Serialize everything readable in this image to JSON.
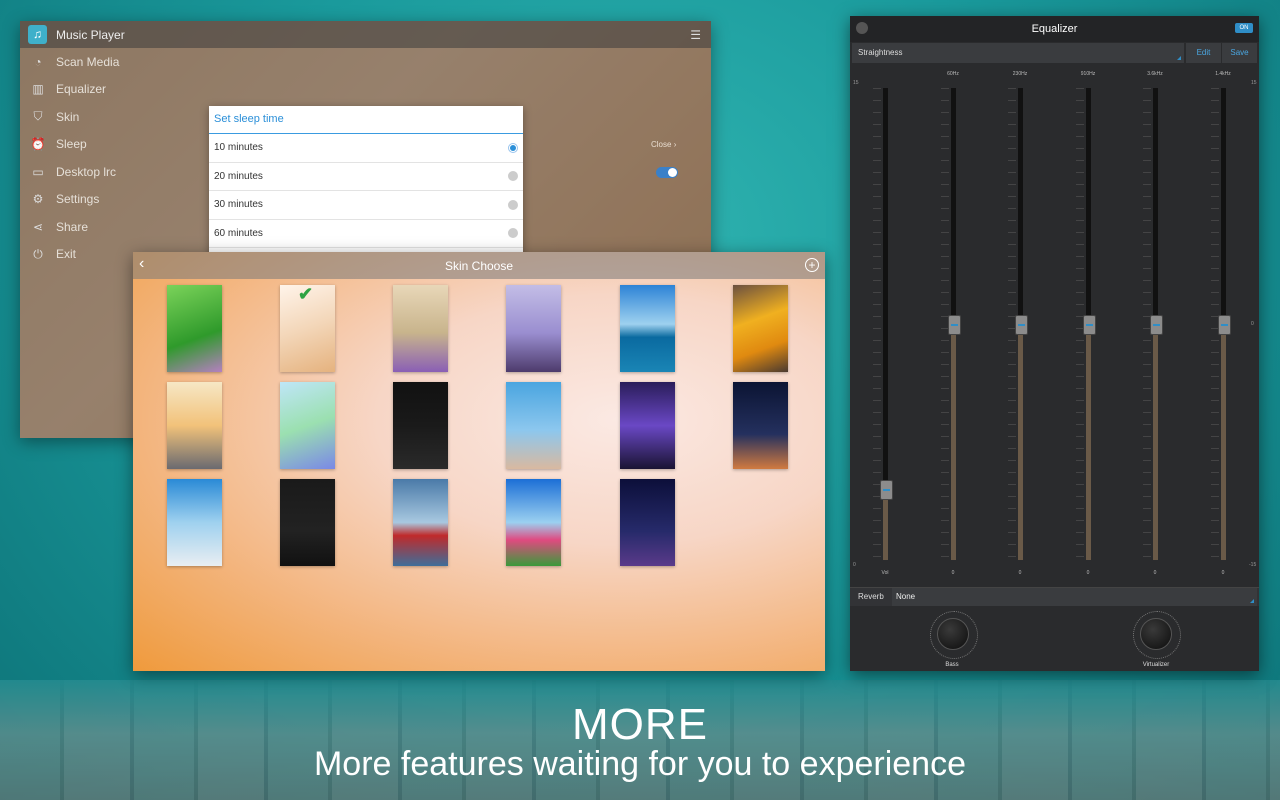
{
  "player": {
    "title": "Music Player",
    "menu": [
      {
        "label": "Scan Media",
        "icon": "scan-icon"
      },
      {
        "label": "Equalizer",
        "icon": "equalizer-icon"
      },
      {
        "label": "Skin",
        "icon": "shirt-icon"
      },
      {
        "label": "Sleep",
        "icon": "alarm-icon"
      },
      {
        "label": "Desktop lrc",
        "icon": "lyrics-icon"
      },
      {
        "label": "Settings",
        "icon": "gear-icon"
      },
      {
        "label": "Share",
        "icon": "share-icon"
      },
      {
        "label": "Exit",
        "icon": "power-icon"
      }
    ],
    "close_text": "Close"
  },
  "sleep_dialog": {
    "title": "Set sleep time",
    "options": [
      "10 minutes",
      "20 minutes",
      "30 minutes",
      "60 minutes"
    ],
    "selected": "10 minutes"
  },
  "skin": {
    "title": "Skin Choose",
    "selected_index": 1,
    "thumbnails": [
      "green-flower",
      "cherry-blossom",
      "purple-flowers",
      "lavender-sky",
      "ocean-sunset",
      "yellow-flowers",
      "pier-sunset",
      "butterfly",
      "dark-rose",
      "red-heart-balloons",
      "night-bokeh",
      "dusk-sky",
      "wooden-pier",
      "dandelion",
      "red-maple-leaf",
      "daisy-field",
      "city-tower-night"
    ]
  },
  "equalizer": {
    "title": "Equalizer",
    "power": "ON",
    "preset": "Straightness",
    "edit_label": "Edit",
    "save_label": "Save",
    "scale_top": "15",
    "scale_mid": "0",
    "scale_bottom": "-15",
    "scale_left_top": "15",
    "scale_left_bottom": "0",
    "bands": [
      {
        "freq": "",
        "label": "Vol",
        "level": 0.15
      },
      {
        "freq": "60Hz",
        "label": "0",
        "level": 0.5
      },
      {
        "freq": "230Hz",
        "label": "0",
        "level": 0.5
      },
      {
        "freq": "910Hz",
        "label": "0",
        "level": 0.5
      },
      {
        "freq": "3.6kHz",
        "label": "0",
        "level": 0.5
      },
      {
        "freq": "1.4kHz",
        "label": "0",
        "level": 0.5
      }
    ],
    "reverb_label": "Reverb",
    "reverb_value": "None",
    "bass_label": "Bass",
    "virtualizer_label": "Virtualizer"
  },
  "caption": {
    "title": "MORE",
    "subtitle": "More features waiting for you to experience"
  }
}
